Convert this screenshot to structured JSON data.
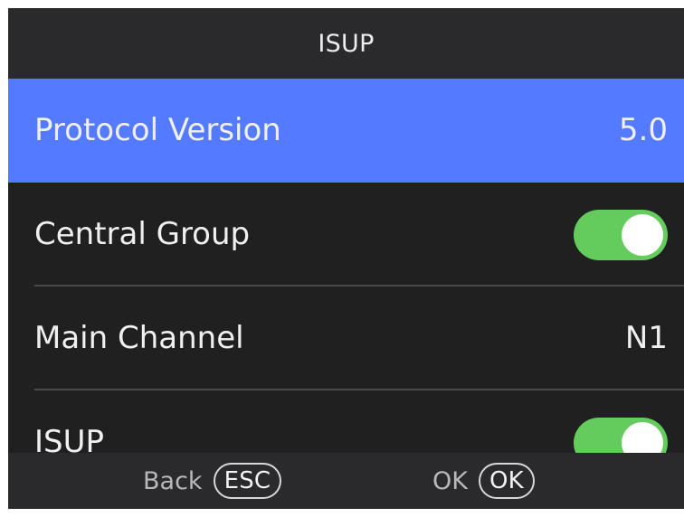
{
  "header": {
    "title": "ISUP"
  },
  "list": {
    "items": [
      {
        "label": "Protocol Version",
        "value": "5.0",
        "selected": true
      },
      {
        "label": "Central Group",
        "toggle": true,
        "toggle_state": "on"
      },
      {
        "label": "Main Channel",
        "value": "N1"
      },
      {
        "label": "ISUP",
        "toggle": true,
        "toggle_state": "on"
      }
    ]
  },
  "footer": {
    "back_label": "Back",
    "back_key": "ESC",
    "ok_label": "OK",
    "ok_key": "OK"
  },
  "colors": {
    "selected_row": "#547bff",
    "toggle_on": "#64cc5d",
    "background": "#202021",
    "bar_background": "#2a2a2d"
  }
}
